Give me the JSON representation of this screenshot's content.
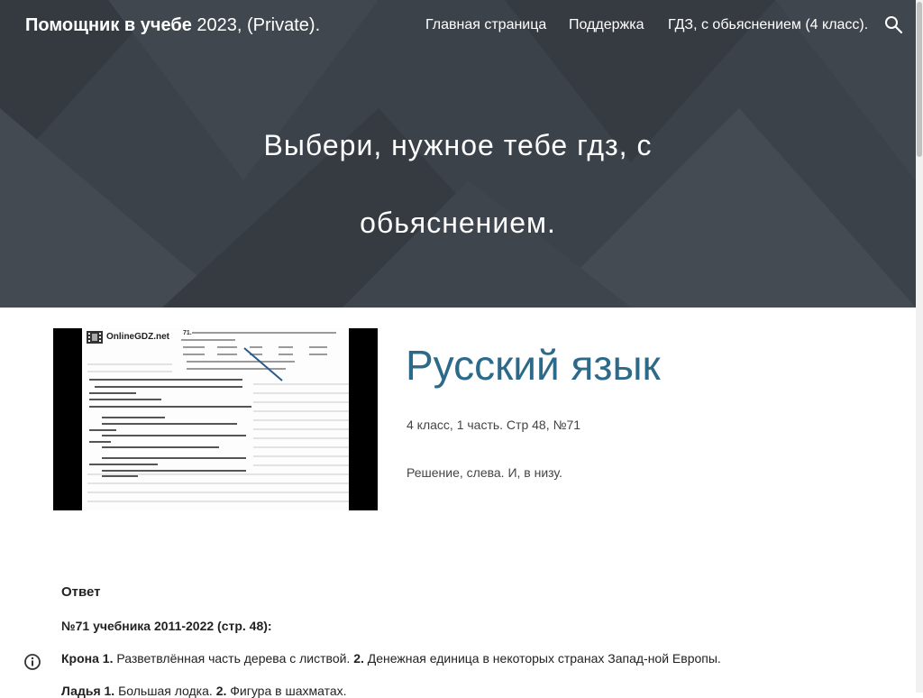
{
  "header": {
    "site_title_bold": "Помощник в учебе",
    "site_title_rest": "2023, (Private).",
    "nav": [
      {
        "label": "Главная страница"
      },
      {
        "label": "Поддержка"
      },
      {
        "label": "ГДЗ, с обьяснением (4 класс)."
      }
    ],
    "search_icon": "search-icon"
  },
  "hero": {
    "title_line1": "Выбери, нужное тебе гдз, с",
    "title_line2": "обьяснением."
  },
  "article": {
    "thumbnail": {
      "logo_text": "OnlineGDZ.net",
      "exercise_number": "71."
    },
    "subject": "Русский язык",
    "meta": "4 класс, 1 часть. Стр 48, №71",
    "solution_hint": "Решение, слева. И, в низу.",
    "answer_heading": "Ответ",
    "book_heading": "№71 учебника 2011-2022 (стр. 48):",
    "lines": [
      {
        "term": "Крона",
        "n1": "1.",
        "d1": "Разветвлённая часть дерева с листвой.",
        "n2": "2.",
        "d2": "Денежная единица в некоторых странах Запад-ной Европы."
      },
      {
        "term": "Ладья",
        "n1": "1.",
        "d1": "Большая лодка.",
        "n2": "2.",
        "d2": "Фигура в шахматах."
      }
    ]
  },
  "footer": {
    "info_icon": "info-icon"
  }
}
